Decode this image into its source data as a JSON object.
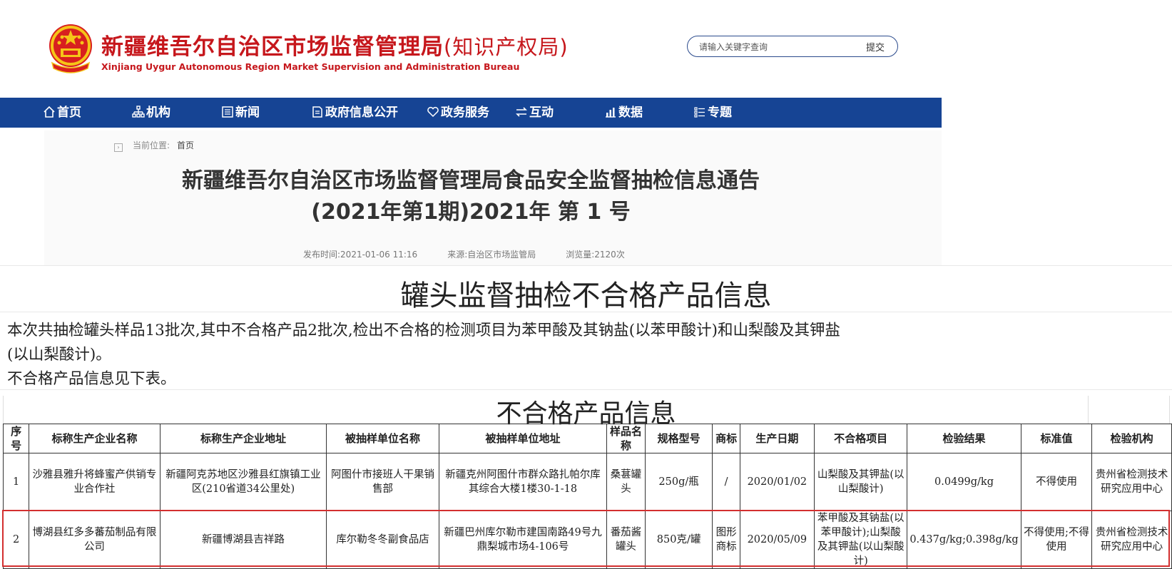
{
  "header": {
    "site_title": "新疆维吾尔自治区市场监督管理局",
    "site_title_suffix": "(知识产权局)",
    "site_title_en": "Xinjiang Uygur Autonomous Region Market Supervision and Administration Bureau",
    "search_placeholder": "请输入关键字查询",
    "search_button": "提交"
  },
  "nav": {
    "items": [
      {
        "label": "首页",
        "icon": "home-icon"
      },
      {
        "label": "机构",
        "icon": "org-chart-icon"
      },
      {
        "label": "新闻",
        "icon": "news-icon"
      },
      {
        "label": "政府信息公开",
        "icon": "document-icon"
      },
      {
        "label": "政务服务",
        "icon": "heart-icon"
      },
      {
        "label": "互动",
        "icon": "exchange-icon"
      },
      {
        "label": "数据",
        "icon": "bar-chart-icon"
      },
      {
        "label": "专题",
        "icon": "list-icon"
      }
    ]
  },
  "breadcrumb": {
    "label": "当前位置:",
    "home": "首页"
  },
  "article": {
    "title_line1": "新疆维吾尔自治区市场监督管理局食品安全监督抽检信息通告",
    "title_line2": "(2021年第1期)2021年 第 1 号",
    "published": "发布时间:2021-01-06 11:16",
    "source": "来源:自治区市场监管局",
    "views": "浏览量:2120次"
  },
  "document": {
    "title": "罐头监督抽检不合格产品信息",
    "para1_line1": "    本次共抽检罐头样品13批次,其中不合格产品2批次,检出不合格的检测项目为苯甲酸及其钠盐(以苯甲酸计)和山梨酸及其钾盐",
    "para1_line2": "(以山梨酸计)。",
    "para2": "    不合格产品信息见下表。",
    "table_title": "不合格产品信息"
  },
  "table": {
    "headers": [
      "序号",
      "标称生产企业名称",
      "标称生产企业地址",
      "被抽样单位名称",
      "被抽样单位地址",
      "样品名称",
      "规格型号",
      "商标",
      "生产日期",
      "不合格项目",
      "检验结果",
      "标准值",
      "检验机构"
    ],
    "rows": [
      [
        "1",
        "沙雅县雅升将蜂蜜产供销专业合作社",
        "新疆阿克苏地区沙雅县红旗镇工业区(210省道34公里处)",
        "阿图什市接班人干果销售部",
        "新疆克州阿图什市群众路扎帕尔库其综合大楼1楼30-1-18",
        "桑葚罐头",
        "250g/瓶",
        "/",
        "2020/01/02",
        "山梨酸及其钾盐(以山梨酸计)",
        "0.0499g/kg",
        "不得使用",
        "贵州省检测技术研究应用中心"
      ],
      [
        "2",
        "博湖县红多多蕃茄制品有限公司",
        "新疆博湖县吉祥路",
        "库尔勒冬冬副食品店",
        "新疆巴州库尔勒市建国南路49号九鼎梨城市场4-106号",
        "番茄酱罐头",
        "850克/罐",
        "图形商标",
        "2020/05/09",
        "苯甲酸及其钠盐(以苯甲酸计);山梨酸及其钾盐(以山梨酸计)",
        "0.437g/kg;0.398g/kg",
        "不得使用;不得使用",
        "贵州省检测技术研究应用中心"
      ]
    ]
  },
  "colors": {
    "brand_red": "#c6171c",
    "nav_blue": "#164494",
    "highlight_red": "#d32f2f"
  }
}
